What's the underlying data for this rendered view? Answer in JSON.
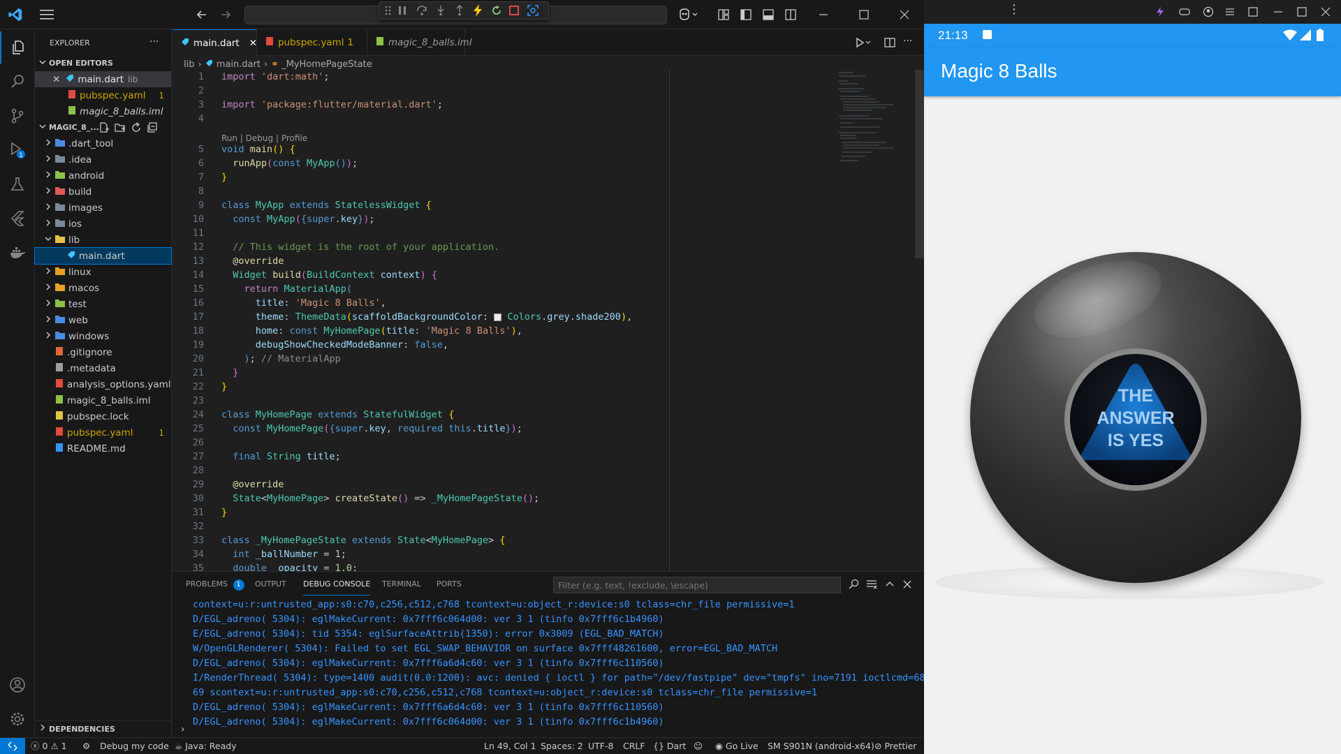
{
  "titlebar": {
    "search_value": ""
  },
  "sidebar": {
    "explorer_title": "EXPLORER",
    "open_editors_title": "OPEN EDITORS",
    "open_editors": [
      {
        "name": "main.dart",
        "detail": "lib",
        "badge": ""
      },
      {
        "name": "pubspec.yaml",
        "detail": "",
        "badge": "1"
      },
      {
        "name": "magic_8_balls.iml",
        "detail": "",
        "badge": ""
      }
    ],
    "project_title": "MAGIC_8_...",
    "tree": [
      {
        "name": ".dart_tool",
        "badge": ""
      },
      {
        "name": ".idea",
        "badge": ""
      },
      {
        "name": "android",
        "badge": ""
      },
      {
        "name": "build",
        "badge": ""
      },
      {
        "name": "images",
        "badge": ""
      },
      {
        "name": "ios",
        "badge": ""
      },
      {
        "name": "lib",
        "badge": ""
      },
      {
        "name": "main.dart",
        "badge": ""
      },
      {
        "name": "linux",
        "badge": ""
      },
      {
        "name": "macos",
        "badge": ""
      },
      {
        "name": "test",
        "badge": ""
      },
      {
        "name": "web",
        "badge": ""
      },
      {
        "name": "windows",
        "badge": ""
      },
      {
        "name": ".gitignore",
        "badge": ""
      },
      {
        "name": ".metadata",
        "badge": ""
      },
      {
        "name": "analysis_options.yaml",
        "badge": ""
      },
      {
        "name": "magic_8_balls.iml",
        "badge": ""
      },
      {
        "name": "pubspec.lock",
        "badge": ""
      },
      {
        "name": "pubspec.yaml",
        "badge": "1"
      },
      {
        "name": "README.md",
        "badge": ""
      }
    ],
    "dependencies_title": "DEPENDENCIES"
  },
  "editor": {
    "tabs": [
      {
        "label": "main.dart",
        "badge": ""
      },
      {
        "label": "pubspec.yaml",
        "badge": "1"
      },
      {
        "label": "magic_8_balls.iml",
        "badge": ""
      }
    ],
    "breadcrumb": [
      "lib",
      "main.dart",
      "_MyHomePageState"
    ],
    "codelens": "Run | Debug | Profile",
    "line_numbers": [
      "1",
      "2",
      "3",
      "4",
      "5",
      "6",
      "7",
      "8",
      "9",
      "10",
      "11",
      "12",
      "13",
      "14",
      "15",
      "16",
      "17",
      "18",
      "19",
      "20",
      "21",
      "22",
      "23",
      "24",
      "25",
      "26",
      "27",
      "28",
      "29",
      "30",
      "31",
      "32",
      "33",
      "34",
      "35"
    ]
  },
  "panel": {
    "tabs": [
      "PROBLEMS",
      "OUTPUT",
      "DEBUG CONSOLE",
      "TERMINAL",
      "PORTS"
    ],
    "problems_count": "1",
    "filter_placeholder": "Filter (e.g. text, !exclude, \\escape)",
    "logs": [
      "context=u:r:untrusted_app:s0:c70,c256,c512,c768 tcontext=u:object_r:device:s0 tclass=chr_file permissive=1",
      "D/EGL_adreno( 5304): eglMakeCurrent: 0x7fff6c064d00: ver 3 1 (tinfo 0x7fff6c1b4960)",
      "E/EGL_adreno( 5304): tid 5354: eglSurfaceAttrib(1350): error 0x3009 (EGL_BAD_MATCH)",
      "W/OpenGLRenderer( 5304): Failed to set EGL_SWAP_BEHAVIOR on surface 0x7fff48261600, error=EGL_BAD_MATCH",
      "D/EGL_adreno( 5304): eglMakeCurrent: 0x7fff6a6d4c60: ver 3 1 (tinfo 0x7fff6c110560)",
      "I/RenderThread( 5304): type=1400 audit(0.0:1200): avc: denied { ioctl } for path=\"/dev/fastpipe\" dev=\"tmpfs\" ino=7191 ioctlcmd=68",
      "69 scontext=u:r:untrusted_app:s0:c70,c256,c512,c768 tcontext=u:object_r:device:s0 tclass=chr_file permissive=1",
      "D/EGL_adreno( 5304): eglMakeCurrent: 0x7fff6a6d4c60: ver 3 1 (tinfo 0x7fff6c110560)",
      "D/EGL_adreno( 5304): eglMakeCurrent: 0x7fff6c064d00: ver 3 1 (tinfo 0x7fff6c1b4960)"
    ]
  },
  "statusbar": {
    "errors": "0",
    "warnings": "1",
    "debug": "Debug my code",
    "java": "Java: Ready",
    "position": "Ln 49, Col 1",
    "spaces": "Spaces: 2",
    "encoding": "UTF-8",
    "eol": "CRLF",
    "language": "Dart",
    "golive": "Go Live",
    "device": "SM S901N (android-x64)",
    "prettier": "Prettier"
  },
  "emulator": {
    "time": "21:13",
    "app_title": "Magic 8 Balls",
    "answer_lines": [
      "THE",
      "ANSWER",
      "IS YES"
    ]
  },
  "colors": {
    "accent": "#0078d4",
    "android_primary": "#2196f3"
  }
}
